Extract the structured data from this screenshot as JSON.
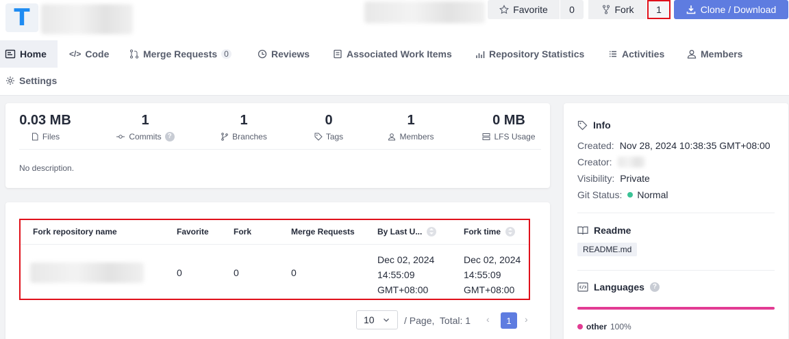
{
  "header": {
    "favorite_label": "Favorite",
    "favorite_count": "0",
    "fork_label": "Fork",
    "fork_count": "1",
    "clone_label": "Clone / Download"
  },
  "tabs": [
    {
      "label": "Home",
      "icon": "home-icon"
    },
    {
      "label": "Code",
      "icon": "code-icon"
    },
    {
      "label": "Merge Requests",
      "badge": "0",
      "icon": "merge-icon"
    },
    {
      "label": "Reviews",
      "icon": "review-icon"
    },
    {
      "label": "Associated Work Items",
      "icon": "workitem-icon"
    },
    {
      "label": "Repository Statistics",
      "icon": "stats-icon"
    },
    {
      "label": "Activities",
      "icon": "list-icon"
    },
    {
      "label": "Members",
      "icon": "user-icon"
    },
    {
      "label": "Settings",
      "icon": "gear-icon"
    }
  ],
  "stats": [
    {
      "value": "0.03 MB",
      "label": "Files",
      "icon": "file-icon"
    },
    {
      "value": "1",
      "label": "Commits",
      "icon": "commit-icon"
    },
    {
      "value": "1",
      "label": "Branches",
      "icon": "branch-icon"
    },
    {
      "value": "0",
      "label": "Tags",
      "icon": "tag-icon"
    },
    {
      "value": "1",
      "label": "Members",
      "icon": "members-icon"
    },
    {
      "value": "0 MB",
      "label": "LFS Usage",
      "icon": "storage-icon"
    }
  ],
  "description": "No description.",
  "fork_table": {
    "columns": [
      "Fork repository name",
      "Favorite",
      "Fork",
      "Merge Requests",
      "By Last U...",
      "Fork time"
    ],
    "rows": [
      {
        "favorite": "0",
        "fork": "0",
        "merge_requests": "0",
        "last_update": [
          "Dec 02, 2024",
          "14:55:09",
          "GMT+08:00"
        ],
        "fork_time": [
          "Dec 02, 2024",
          "14:55:09",
          "GMT+08:00"
        ]
      }
    ]
  },
  "pagination": {
    "page_size": "10",
    "per_page_label": "/ Page,",
    "total_label": "Total: 1",
    "current_page": "1"
  },
  "info": {
    "title": "Info",
    "created_label": "Created:",
    "created_value": "Nov 28, 2024 10:38:35 GMT+08:00",
    "creator_label": "Creator:",
    "visibility_label": "Visibility:",
    "visibility_value": "Private",
    "git_status_label": "Git Status:",
    "git_status_value": "Normal"
  },
  "readme": {
    "title": "Readme",
    "file": "README.md"
  },
  "languages": {
    "title": "Languages",
    "items": [
      {
        "name": "other",
        "percent": "100%",
        "color": "#e23c93"
      }
    ]
  },
  "colors": {
    "primary": "#5e7ce0",
    "highlight_border": "#e0101a",
    "status_ok": "#3ac295"
  }
}
